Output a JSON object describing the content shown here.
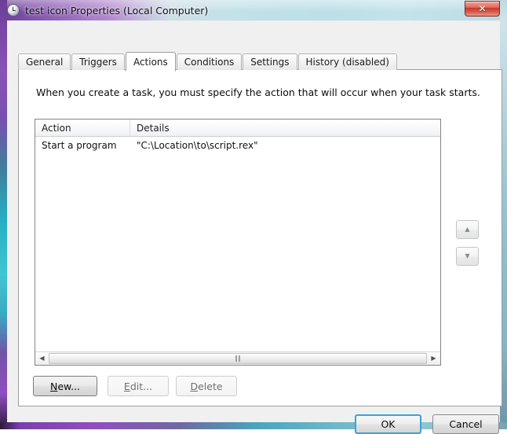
{
  "window": {
    "title": "test icon Properties (Local Computer)",
    "icon": "clock-icon",
    "close_label": "✕"
  },
  "tabs": [
    {
      "label": "General",
      "selected": false
    },
    {
      "label": "Triggers",
      "selected": false
    },
    {
      "label": "Actions",
      "selected": true
    },
    {
      "label": "Conditions",
      "selected": false
    },
    {
      "label": "Settings",
      "selected": false
    },
    {
      "label": "History (disabled)",
      "selected": false
    }
  ],
  "page": {
    "instruction": "When you create a task, you must specify the action that will occur when your task starts."
  },
  "action_list": {
    "columns": [
      "Action",
      "Details"
    ],
    "rows": [
      {
        "action": "Start a program",
        "details": "\"C:\\Location\\to\\script.rex\""
      }
    ],
    "scrollbar": {
      "left_arrow": "◀",
      "right_arrow": "▶",
      "grip": "‖‖"
    }
  },
  "move_buttons": {
    "up_glyph": "▲",
    "down_glyph": "▼"
  },
  "lower_buttons": [
    {
      "prefix": "",
      "mnemonic": "N",
      "suffix": "ew...",
      "enabled": true
    },
    {
      "prefix": "",
      "mnemonic": "E",
      "suffix": "dit...",
      "enabled": false
    },
    {
      "prefix": "",
      "mnemonic": "D",
      "suffix": "elete",
      "enabled": false
    }
  ],
  "dialog_buttons": {
    "ok": "OK",
    "cancel": "Cancel"
  },
  "colors": {
    "frame_purple": "#8a52b8",
    "frame_cyan": "#39c0cf",
    "dialog_bg": "#f0f0f0",
    "page_bg": "#ffffff",
    "close_red": "#c63a2b",
    "focus_blue": "#3aa4d8"
  }
}
